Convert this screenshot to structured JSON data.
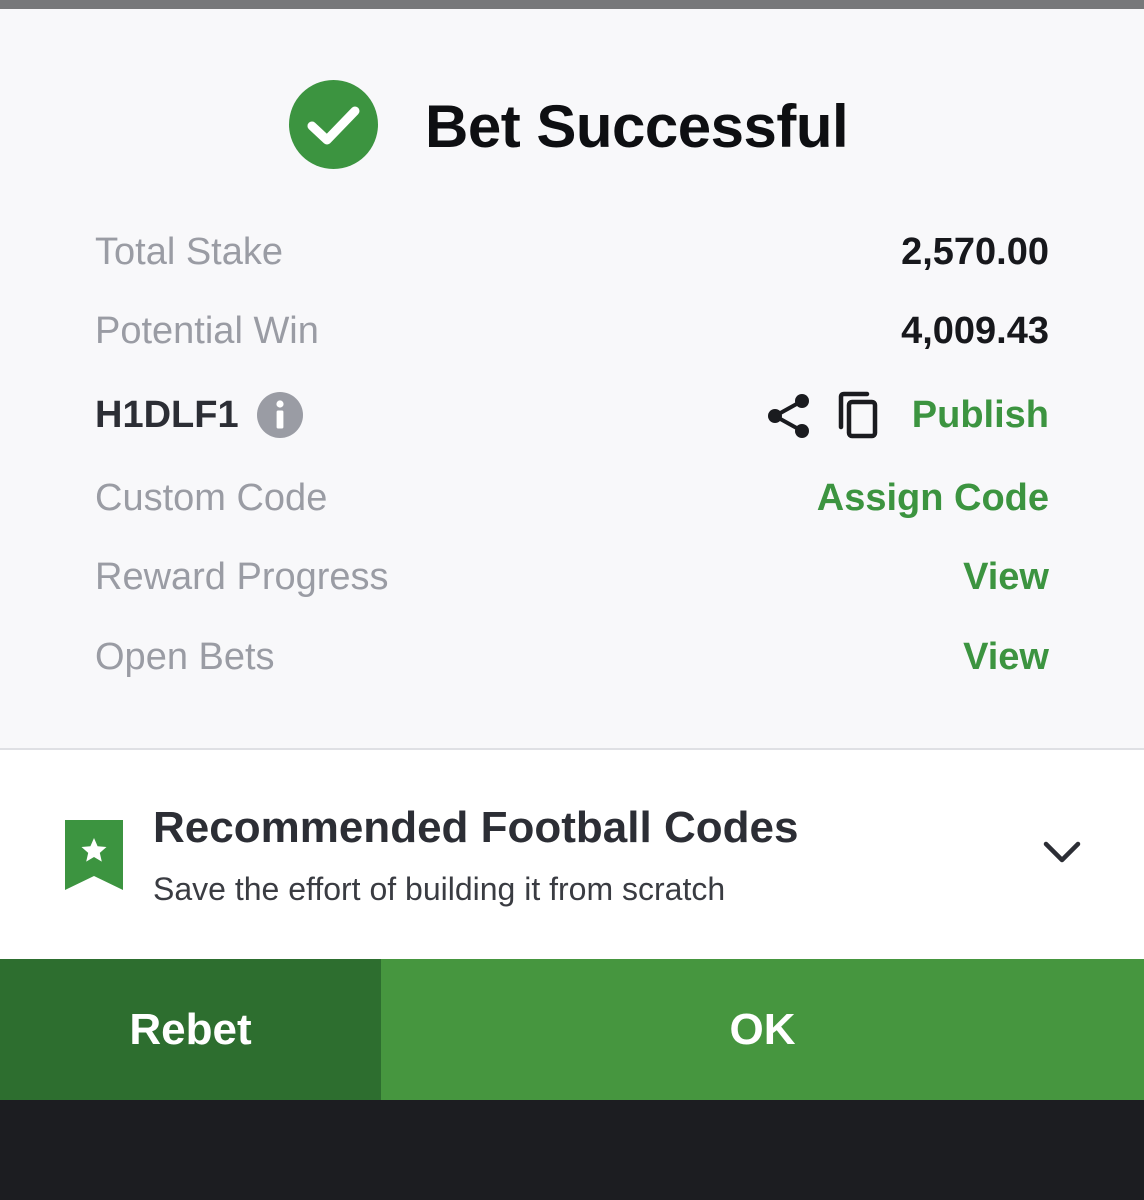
{
  "dialog": {
    "title": "Bet Successful",
    "icon": "check-circle-icon"
  },
  "summary": {
    "total_stake_label": "Total Stake",
    "total_stake_value": "2,570.00",
    "potential_win_label": "Potential Win",
    "potential_win_value": "4,009.43",
    "booking_code": "H1DLF1",
    "publish_label": "Publish",
    "custom_code_label": "Custom Code",
    "assign_code_label": "Assign Code",
    "reward_progress_label": "Reward Progress",
    "reward_progress_action": "View",
    "open_bets_label": "Open Bets",
    "open_bets_action": "View"
  },
  "recommended": {
    "title": "Recommended Football Codes",
    "subtitle": "Save the effort of building it from scratch"
  },
  "actions": {
    "rebet_label": "Rebet",
    "ok_label": "OK"
  },
  "colors": {
    "accent_green": "#3c9440",
    "ok_button": "#46963f",
    "rebet_button": "#2d6e2f",
    "label_gray": "#9a9ca4",
    "bottom_bar": "#1c1d21"
  }
}
